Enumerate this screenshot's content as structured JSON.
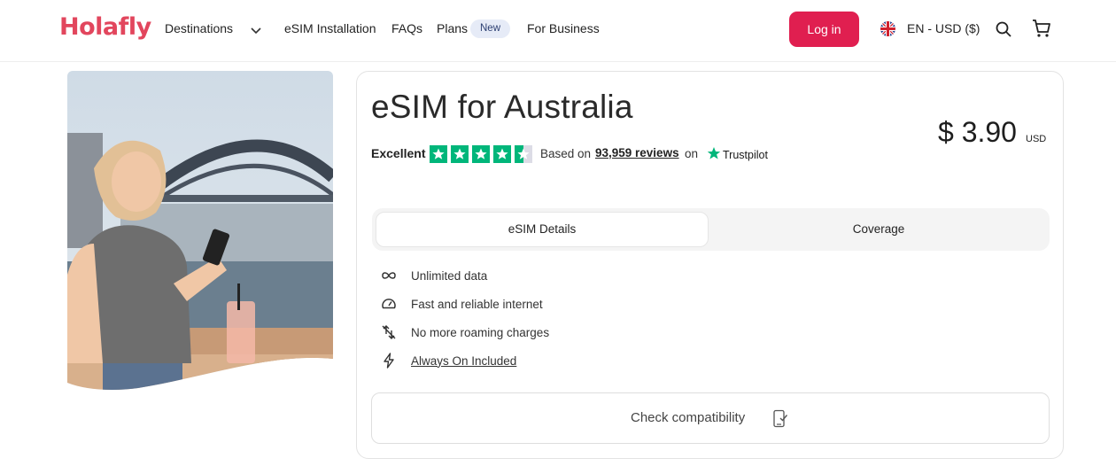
{
  "header": {
    "logo": "Holafly",
    "nav": {
      "destinations": "Destinations",
      "install": "eSIM Installation",
      "faqs": "FAQs",
      "plans": "Plans",
      "plans_badge": "New",
      "business": "For Business"
    },
    "login": "Log in",
    "locale": "EN - USD ($)",
    "icons": [
      "uk-flag-icon",
      "search-icon",
      "cart-icon",
      "chevron-down-icon"
    ]
  },
  "product": {
    "title": "eSIM for Australia",
    "price": "$ 3.90",
    "currency": "USD",
    "rating": {
      "label": "Excellent",
      "stars": 4.5,
      "based_on": "Based on",
      "reviews": "93,959 reviews",
      "on": "on",
      "platform": "Trustpilot"
    },
    "tabs": [
      {
        "label": "eSIM Details",
        "active": true
      },
      {
        "label": "Coverage",
        "active": false
      }
    ],
    "features": [
      {
        "icon": "infinity-icon",
        "label": "Unlimited data"
      },
      {
        "icon": "speedometer-icon",
        "label": "Fast and reliable internet"
      },
      {
        "icon": "no-roaming-icon",
        "label": "No more roaming charges"
      },
      {
        "icon": "lightning-icon",
        "label": "Always On Included"
      }
    ],
    "check_button": "Check compatibility"
  },
  "colors": {
    "brand": "#e2465d",
    "login": "#e01f50",
    "trustpilot": "#00b67a"
  }
}
